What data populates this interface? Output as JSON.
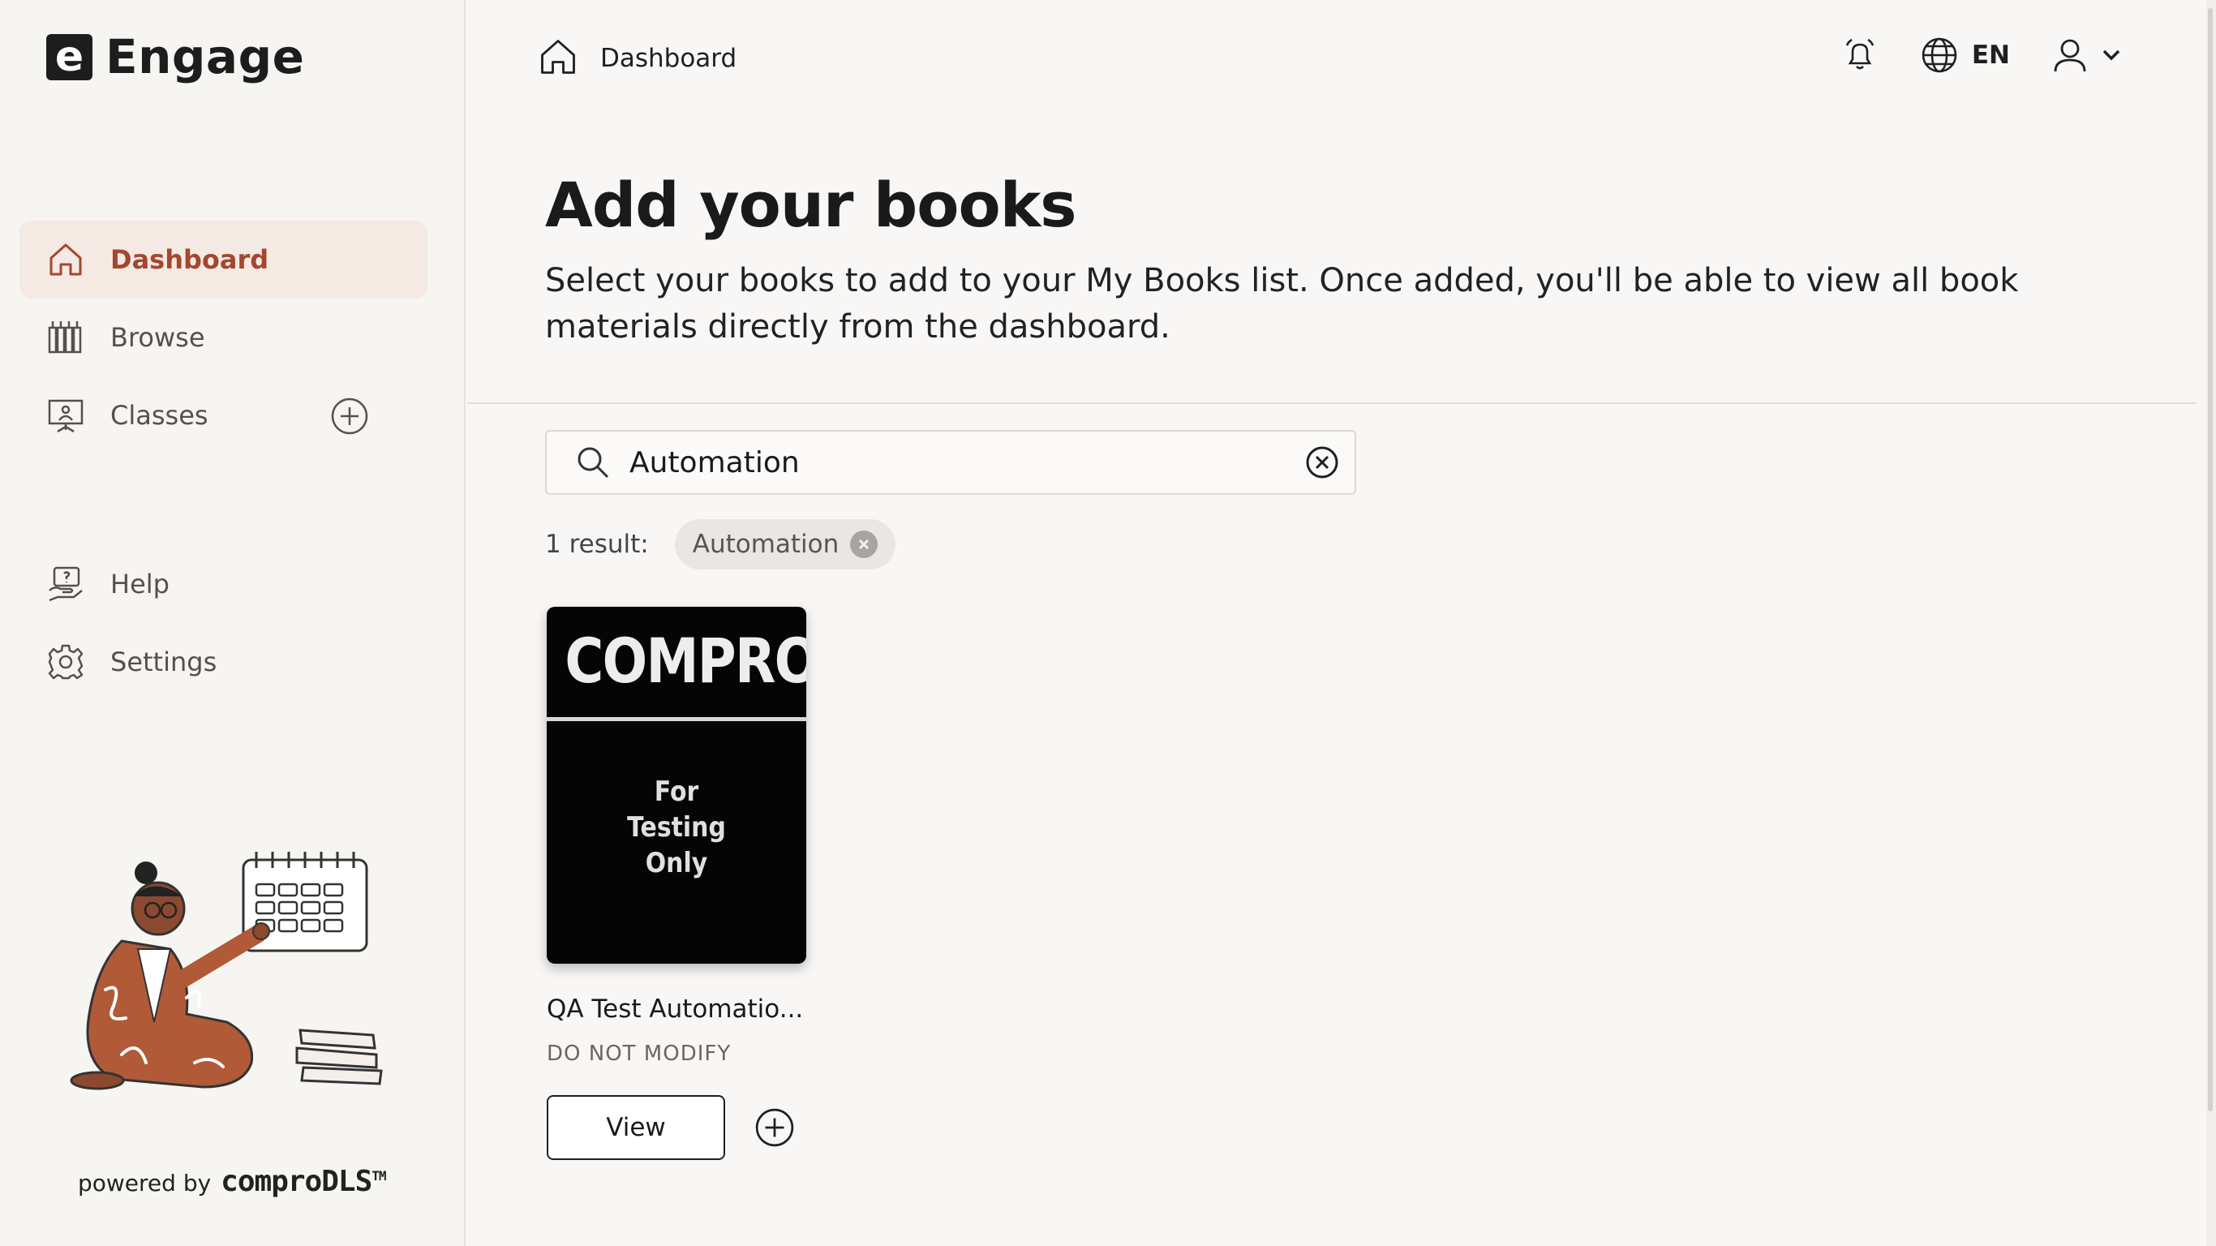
{
  "app": {
    "logo_letter": "e",
    "name": "Engage"
  },
  "sidebar": {
    "items": [
      {
        "label": "Dashboard",
        "icon": "home-icon",
        "active": true
      },
      {
        "label": "Browse",
        "icon": "library-icon",
        "active": false
      },
      {
        "label": "Classes",
        "icon": "classroom-icon",
        "active": false
      },
      {
        "label": "Help",
        "icon": "help-icon",
        "active": false
      },
      {
        "label": "Settings",
        "icon": "gear-icon",
        "active": false
      }
    ],
    "powered_by": "powered by",
    "powered_brand": "comproDLS",
    "powered_tm": "TM"
  },
  "header": {
    "breadcrumb": "Dashboard",
    "language": "EN"
  },
  "main": {
    "title": "Add your books",
    "description": "Select your books to add to your My Books list. Once added, you'll be able to view all book materials directly from the dashboard.",
    "search": {
      "value": "Automation",
      "placeholder": ""
    },
    "result_count": "1 result:",
    "filter_chip": "Automation"
  },
  "books": [
    {
      "cover_brand": "COMPRO",
      "cover_tag": [
        "For",
        "Testing",
        "Only"
      ],
      "title": "QA Test Automatio...",
      "subtitle": "DO NOT MODIFY",
      "view_label": "View"
    }
  ],
  "colors": {
    "accent": "#a4472e",
    "active_bg": "#f5e9e4",
    "background": "#f9f7f5"
  }
}
